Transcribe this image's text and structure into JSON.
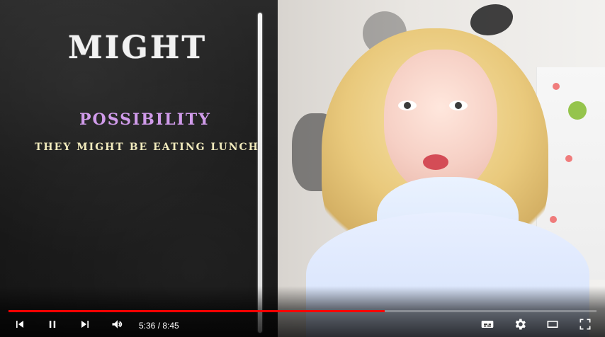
{
  "lesson": {
    "title": "MIGHT",
    "subtitle": "POSSIBILITY",
    "example": "THEY MIGHT BE EATING LUNCH"
  },
  "player": {
    "current_time": "5:36",
    "duration": "8:45",
    "time_display": "5:36 / 8:45",
    "progress": 0.64,
    "accent": "#ff0000"
  },
  "icons": {
    "previous": "skip-previous-icon",
    "pause": "pause-icon",
    "next": "skip-next-icon",
    "volume": "volume-icon",
    "captions": "captions-icon",
    "settings": "settings-icon",
    "theater": "theater-mode-icon",
    "fullscreen": "fullscreen-icon"
  }
}
